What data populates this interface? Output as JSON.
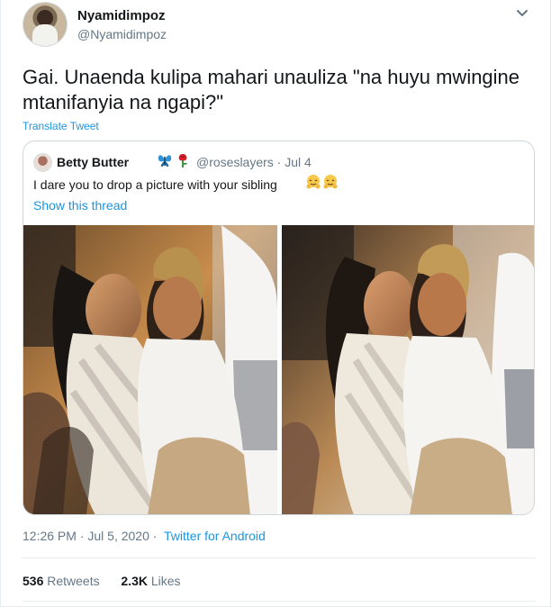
{
  "author": {
    "display_name": "Nyamidimpoz",
    "handle": "@Nyamidimpoz"
  },
  "tweet": {
    "text": "Gai. Unaenda kulipa mahari unauliza \"na huyu mwingine mtanifanyia na ngapi?\"",
    "translate_label": "Translate Tweet"
  },
  "quoted_tweet": {
    "display_name": "Betty Butter",
    "name_emojis": [
      "butterfly-icon",
      "rose-icon"
    ],
    "handle_date": "@roseslayers · Jul 4",
    "text": "I dare you to drop a picture with your sibling",
    "text_emojis": [
      "hugging-face-icon",
      "hugging-face-icon"
    ],
    "show_thread_label": "Show this thread",
    "photos": [
      "photo-1",
      "photo-2"
    ]
  },
  "footer": {
    "timestamp": "12:26 PM · Jul 5, 2020 ·",
    "source": "Twitter for Android",
    "retweets_count": "536",
    "retweets_label": "Retweets",
    "likes_count": "2.3K",
    "likes_label": "Likes"
  },
  "colors": {
    "link": "#1b95e0",
    "muted": "#657786",
    "border": "#ccd6dd"
  }
}
